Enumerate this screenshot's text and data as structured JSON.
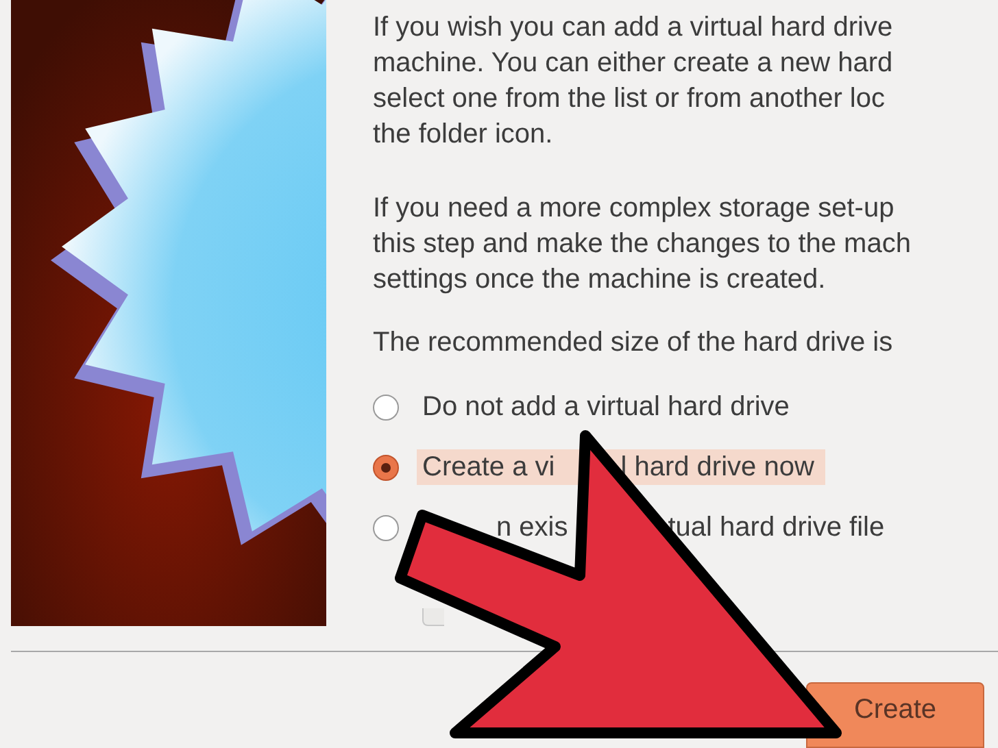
{
  "paragraphs": [
    {
      "lines": [
        "If you wish you can add a virtual hard drive",
        "machine. You can either create a new hard",
        "select one from the list or from another loc",
        "the folder icon."
      ]
    },
    {
      "lines": [
        "If you need a more complex storage set-up",
        "this step and make the changes to the mach",
        "settings once the machine is created."
      ]
    },
    {
      "lines": [
        "The recommended size of the hard drive is"
      ]
    }
  ],
  "options": [
    {
      "selected": false,
      "parts": [
        {
          "text": "Do not add a virtual hard drive"
        }
      ]
    },
    {
      "selected": true,
      "parts": [
        {
          "text": "Create a vi"
        },
        {
          "text": "l hard drive now"
        }
      ]
    },
    {
      "selected": false,
      "parts": [
        {
          "text": "n exis"
        },
        {
          "text": "tual hard drive file"
        }
      ]
    }
  ],
  "buttons": [
    {
      "label": "Create"
    }
  ]
}
